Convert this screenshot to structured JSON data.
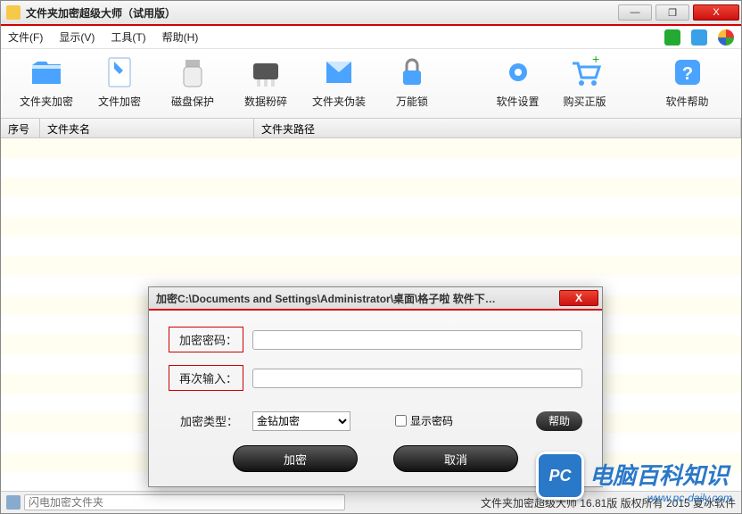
{
  "window": {
    "title": "文件夹加密超级大师（试用版）",
    "btn_min": "—",
    "btn_max": "❐",
    "btn_close": "X"
  },
  "menu": {
    "file": "文件(F)",
    "view": "显示(V)",
    "tools": "工具(T)",
    "help": "帮助(H)"
  },
  "toolbar": {
    "folder_encrypt": "文件夹加密",
    "file_encrypt": "文件加密",
    "disk_protect": "磁盘保护",
    "shred": "数据粉碎",
    "disguise": "文件夹伪装",
    "master_lock": "万能锁",
    "settings": "软件设置",
    "buy": "购买正版",
    "help": "软件帮助"
  },
  "columns": {
    "index": "序号",
    "name": "文件夹名",
    "path": "文件夹路径"
  },
  "statusbar": {
    "search_placeholder": "闪电加密文件夹",
    "copyright": "文件夹加密超级大师 16.81版 版权所有 2015 夏冰软件"
  },
  "dialog": {
    "title": "加密C:\\Documents and Settings\\Administrator\\桌面\\格子啦 软件下…",
    "pwd_label": "加密密码：",
    "pwd2_label": "再次输入：",
    "type_label": "加密类型：",
    "type_value": "金钻加密",
    "show_pwd": "显示密码",
    "help": "帮助",
    "encrypt": "加密",
    "cancel": "取消",
    "close": "X"
  },
  "watermark": {
    "badge": "PC",
    "text": "电脑百科知识",
    "url": "www.pc-daily.com"
  }
}
